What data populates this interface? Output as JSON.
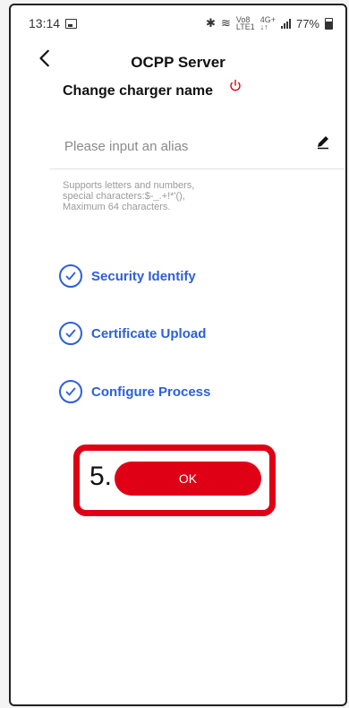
{
  "status": {
    "time": "13:14",
    "net_top": "Vo8",
    "net_bottom": "LTE1",
    "gen_top": "4G+",
    "gen_bottom": "↓↑",
    "battery": "77%"
  },
  "header": {
    "title": "OCPP Server"
  },
  "form": {
    "section_title": "Change charger name",
    "alias_placeholder": "Please input an alias",
    "alias_value": "",
    "hint": "Supports letters and numbers,\nspecial characters:$-_.+!*'(),\nMaximum 64 characters."
  },
  "steps": [
    {
      "label": "Security Identify"
    },
    {
      "label": "Certificate Upload"
    },
    {
      "label": "Configure Process"
    }
  ],
  "callout": {
    "number": "5."
  },
  "actions": {
    "ok_label": "OK"
  },
  "colors": {
    "accent": "#2d5fd8",
    "primary": "#e00016"
  }
}
